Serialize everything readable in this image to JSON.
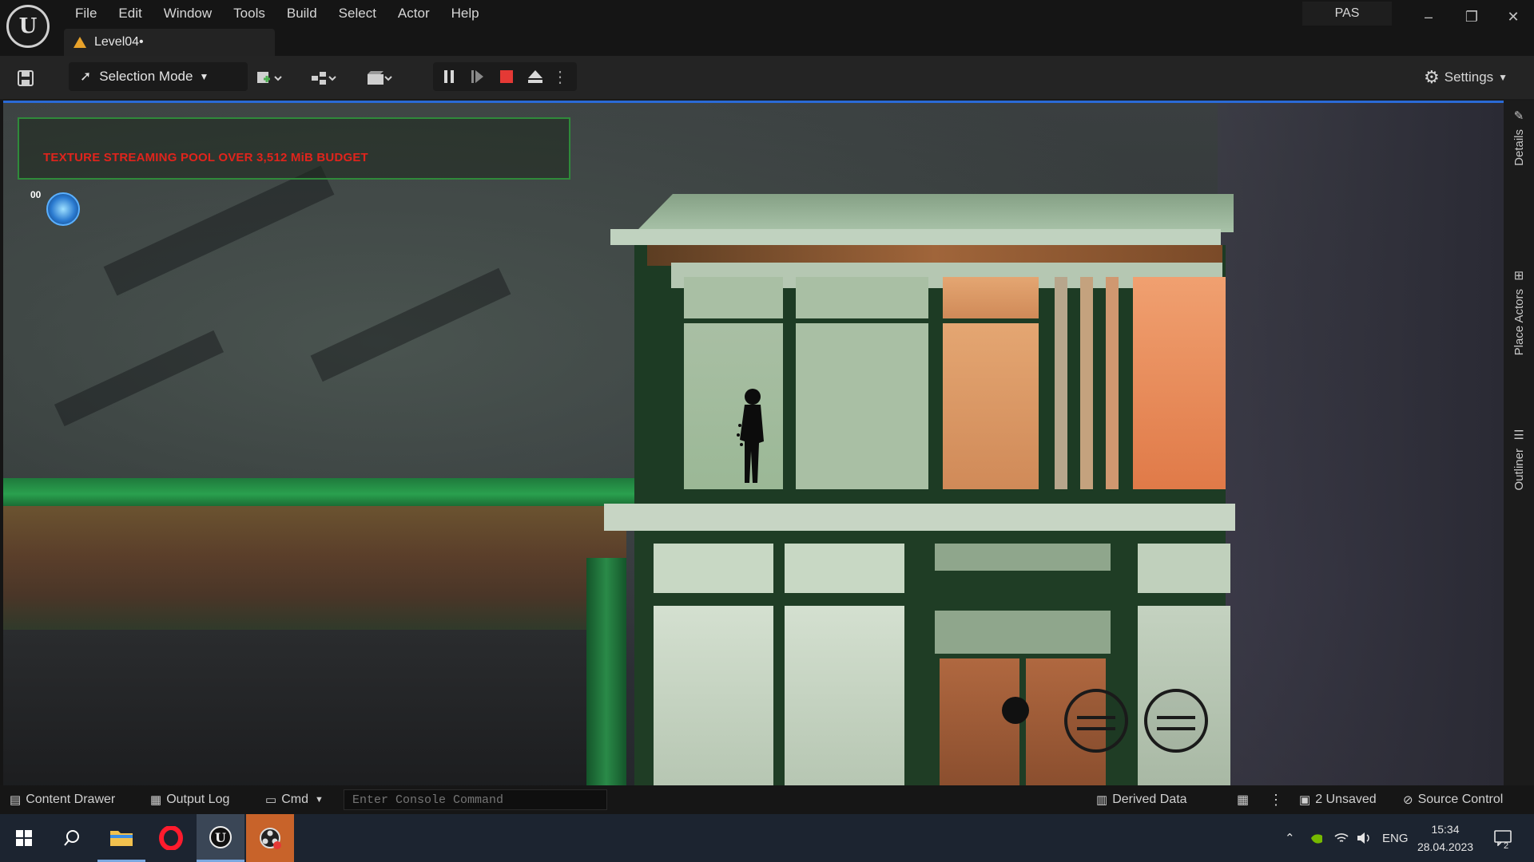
{
  "app": {
    "logo": "U",
    "menu": [
      "File",
      "Edit",
      "Window",
      "Tools",
      "Build",
      "Select",
      "Actor",
      "Help"
    ],
    "level_tab": "Level04•",
    "profile": "PAS",
    "window_controls": {
      "minimize": "–",
      "restore": "❐",
      "close": "✕"
    }
  },
  "toolbar": {
    "selection_mode": "Selection Mode",
    "settings": "Settings",
    "icons": [
      "save-icon",
      "add-actor-icon",
      "blueprint-icon",
      "cinematics-icon",
      "pause-icon",
      "advance-frame-icon",
      "stop-icon",
      "eject-icon",
      "more-options-icon"
    ],
    "accent_stop": "#e53935"
  },
  "viewport": {
    "warning": "TEXTURE STREAMING POOL OVER 3,512 MiB BUDGET",
    "hud_counter": "00"
  },
  "side_panel": {
    "tabs": [
      "Details",
      "Place Actors",
      "Outliner"
    ]
  },
  "statusbar": {
    "content_drawer": "Content Drawer",
    "output_log": "Output Log",
    "cmd": "Cmd",
    "console_placeholder": "Enter Console Command",
    "derived_data": "Derived Data",
    "unsaved": "2 Unsaved",
    "source_control": "Source Control"
  },
  "taskbar": {
    "apps": [
      "windows-start-icon",
      "search-icon",
      "file-explorer-icon",
      "opera-icon",
      "unreal-engine-icon",
      "obs-icon"
    ],
    "language": "ENG",
    "time": "15:34",
    "date": "28.04.2023",
    "notification_count": "2"
  }
}
